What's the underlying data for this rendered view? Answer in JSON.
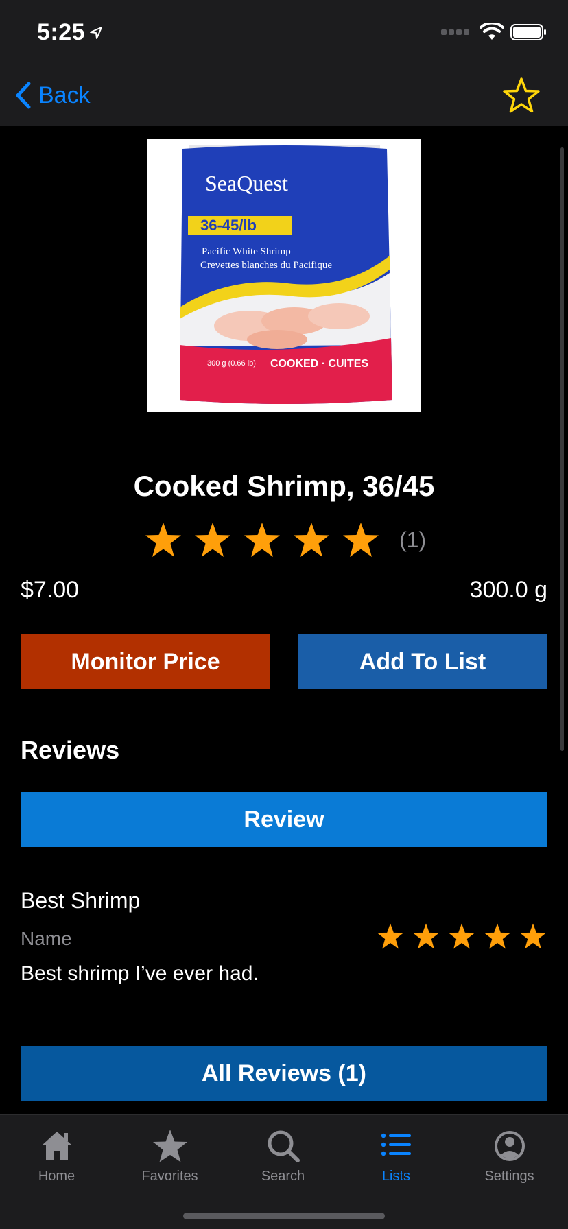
{
  "status_bar": {
    "time": "5:25"
  },
  "nav": {
    "back_label": "Back"
  },
  "product": {
    "title": "Cooked Shrimp, 36/45",
    "rating": 5,
    "rating_count": "(1)",
    "price": "$7.00",
    "weight": "300.0 g",
    "image": {
      "brand": "SeaQuest",
      "count_label": "36-45/lb",
      "name_en": "Pacific White Shrimp",
      "name_fr": "Crevettes blanches du Pacifique",
      "net_weight": "300 g (0.66 lb)",
      "cooked": "COOKED · CUITES"
    }
  },
  "actions": {
    "monitor_price": "Monitor Price",
    "add_to_list": "Add To List"
  },
  "reviews": {
    "heading": "Reviews",
    "review_button": "Review",
    "items": [
      {
        "title": "Best Shrimp",
        "author": "Name",
        "body": "Best shrimp I’ve ever had.",
        "rating": 5
      }
    ],
    "all_reviews_button": "All Reviews (1)"
  },
  "tab_bar": {
    "tabs": [
      {
        "label": "Home",
        "icon": "home-icon"
      },
      {
        "label": "Favorites",
        "icon": "star-icon"
      },
      {
        "label": "Search",
        "icon": "search-icon"
      },
      {
        "label": "Lists",
        "icon": "list-icon",
        "active": true
      },
      {
        "label": "Settings",
        "icon": "person-circle-icon"
      }
    ]
  },
  "colors": {
    "accent": "#0a84ff",
    "star": "#ff9f0a",
    "favorite_star": "#ffd60a",
    "monitor_button": "#b23000",
    "add_list_button": "#1a5ea8",
    "review_button": "#0a7bd6",
    "all_reviews_button": "#06589e"
  }
}
